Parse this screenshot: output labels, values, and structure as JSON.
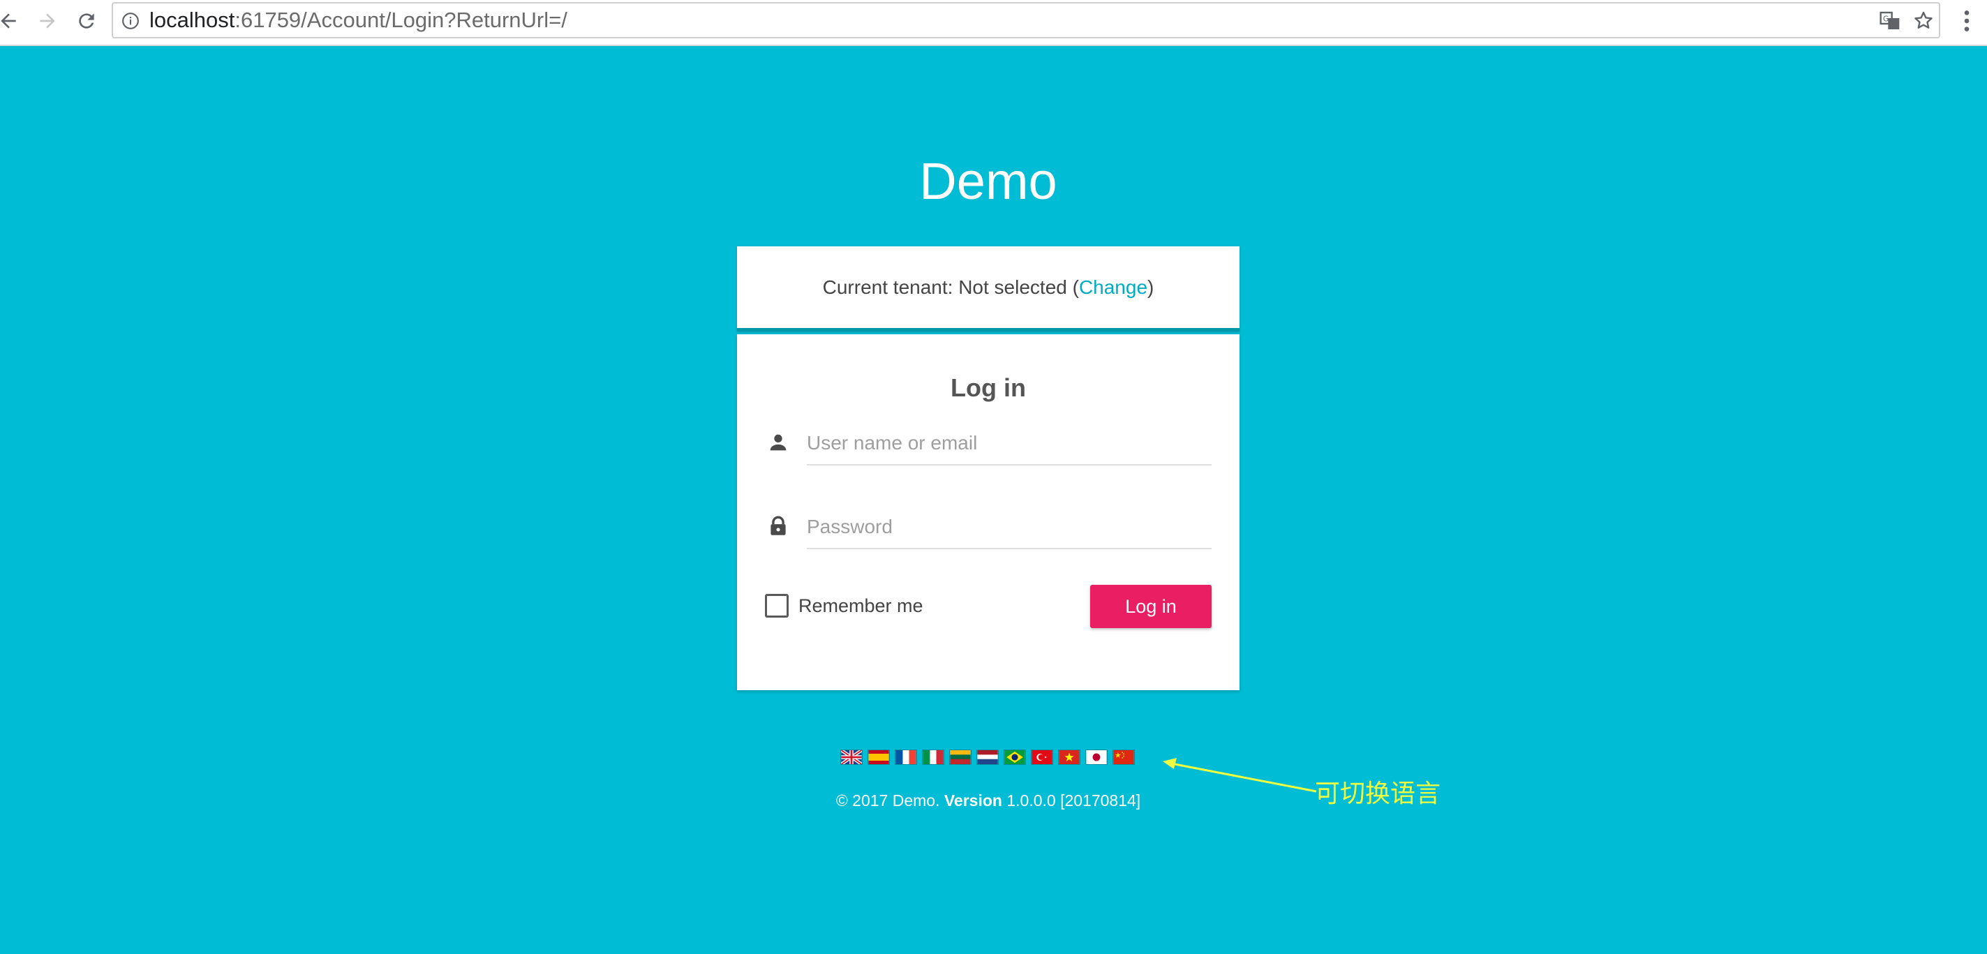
{
  "browser": {
    "url_host": "localhost",
    "url_path": ":61759/Account/Login?ReturnUrl=/"
  },
  "page": {
    "brand": "Demo",
    "tenant": {
      "prefix": "Current tenant: Not selected (",
      "link": "Change",
      "suffix": ")"
    },
    "login": {
      "title": "Log in",
      "username_placeholder": "User name or email",
      "password_placeholder": "Password",
      "remember_label": "Remember me",
      "submit_label": "Log in"
    },
    "languages": [
      "English",
      "Spanish",
      "French",
      "Italian",
      "Lithuanian",
      "Dutch",
      "Portuguese (Brazil)",
      "Turkish",
      "Vietnamese",
      "Japanese",
      "Chinese"
    ],
    "footer": {
      "copyright": "© 2017 Demo. ",
      "version_label": "Version",
      "version_value": " 1.0.0.0 [20170814]"
    },
    "annotation": "可切换语言"
  },
  "colors": {
    "background": "#00bcd4",
    "primary_button": "#e91e63",
    "link": "#00acc1",
    "annotation": "#eeff41"
  }
}
